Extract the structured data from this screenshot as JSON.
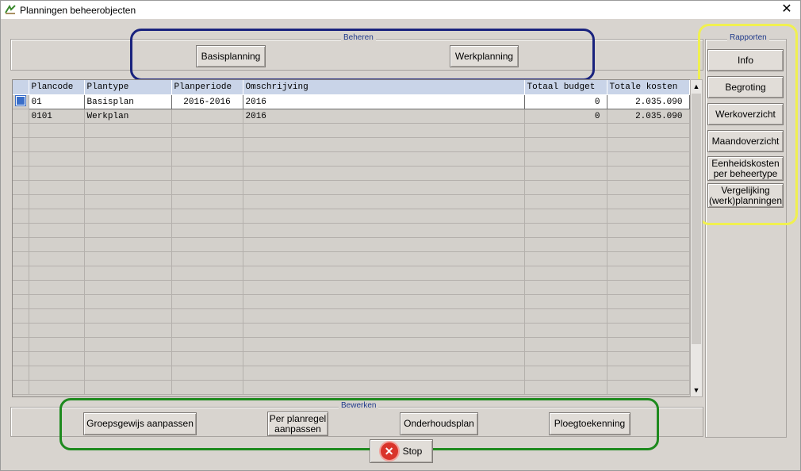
{
  "window": {
    "title": "Planningen beheerobjecten",
    "close_glyph": "✕"
  },
  "beheren": {
    "legend": "Beheren",
    "basisplanning": "Basisplanning",
    "werkplanning": "Werkplanning"
  },
  "rapporten": {
    "legend": "Rapporten",
    "info": "Info",
    "begroting": "Begroting",
    "werkoverzicht": "Werkoverzicht",
    "maandoverzicht": "Maandoverzicht",
    "eenheidskosten_1": "Eenheidskosten",
    "eenheidskosten_2": "per beheertype",
    "vergelijking_1": "Vergelijking",
    "vergelijking_2": "(werk)planningen"
  },
  "grid": {
    "columns": [
      "Plancode",
      "Plantype",
      "Planperiode",
      "Omschrijving",
      "Totaal budget",
      "Totale kosten"
    ],
    "rows": [
      {
        "plancode": "01",
        "plantype": "Basisplan",
        "planperiode": "2016-2016",
        "omschrijving": "2016",
        "budget": "0",
        "kosten": "2.035.090"
      },
      {
        "plancode": "0101",
        "plantype": "Werkplan",
        "planperiode": "",
        "omschrijving": "2016",
        "budget": "0",
        "kosten": "2.035.090"
      }
    ]
  },
  "bewerken": {
    "legend": "Bewerken",
    "groepsgewijs": "Groepsgewijs aanpassen",
    "per_planregel_1": "Per planregel",
    "per_planregel_2": "aanpassen",
    "onderhoudsplan": "Onderhoudsplan",
    "ploegtoekenning": "Ploegtoekenning"
  },
  "stop": {
    "label": "Stop",
    "icon_glyph": "✕"
  },
  "highlights": {
    "beheren": "#1a237e",
    "rapporten": "#f0f050",
    "bewerken": "#1e8a1e"
  }
}
